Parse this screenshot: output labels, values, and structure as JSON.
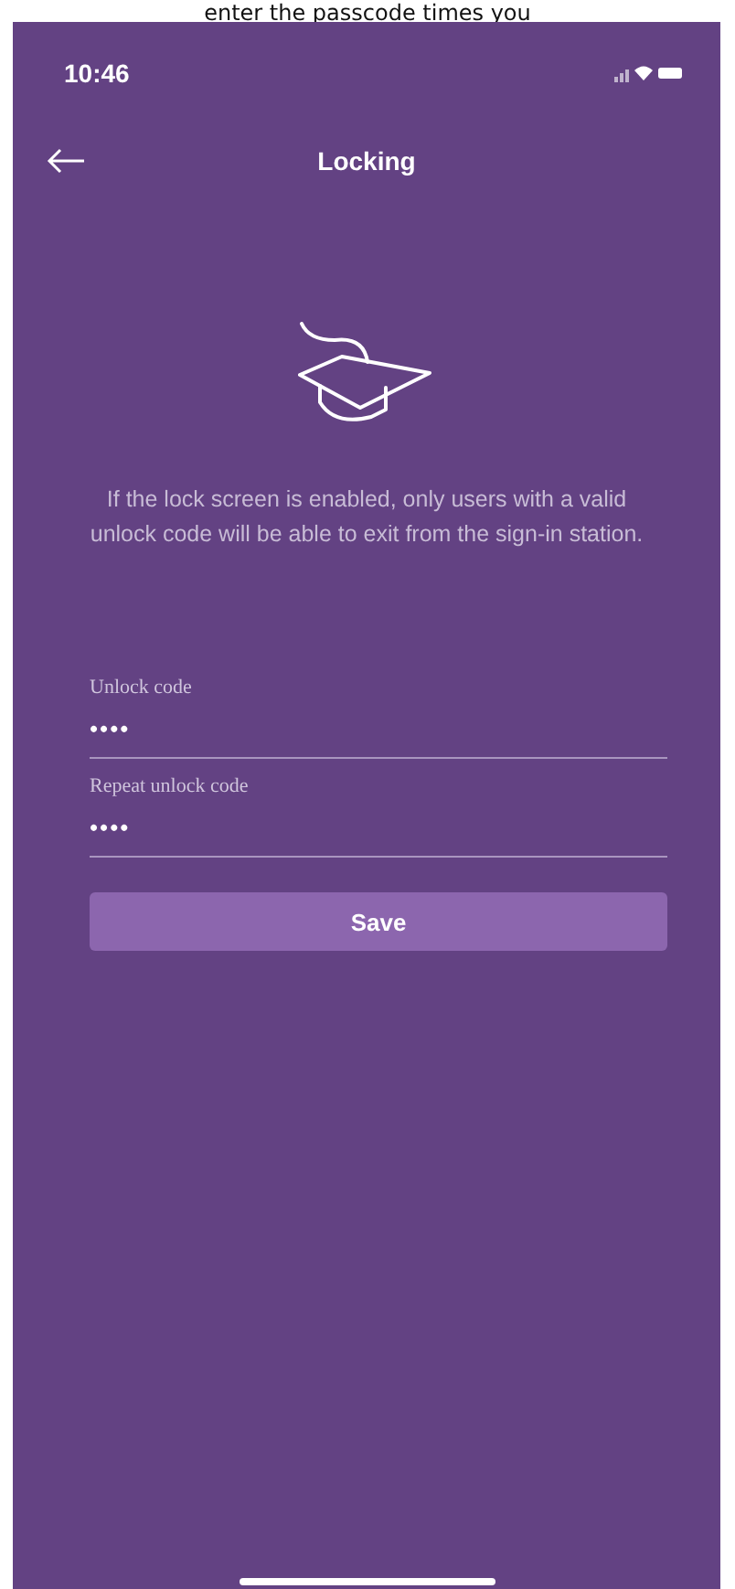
{
  "caption": "enter the passcode times you",
  "status_bar": {
    "time": "10:46"
  },
  "header": {
    "title": "Locking"
  },
  "description": "If the lock screen is enabled, only users with a valid unlock code will be able to exit from the sign-in station.",
  "fields": [
    {
      "label": "Unlock code",
      "value": "••••"
    },
    {
      "label": "Repeat unlock code",
      "value": "••••"
    }
  ],
  "save_button": {
    "label": "Save"
  }
}
